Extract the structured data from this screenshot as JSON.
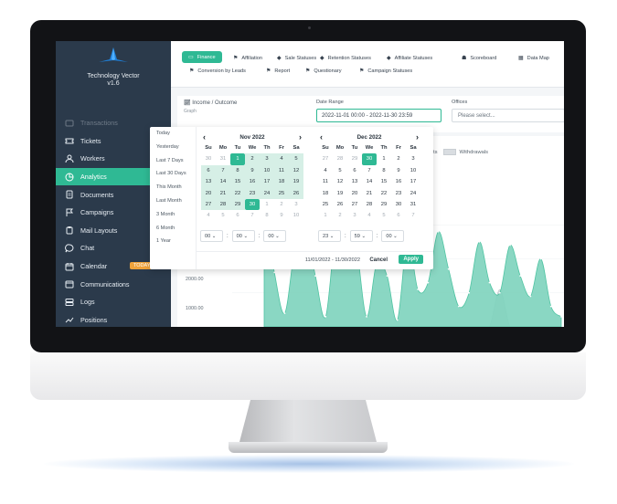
{
  "brand": {
    "name": "Technology Vector",
    "version": "v1.6"
  },
  "sidebar": {
    "items": [
      {
        "label": "Transactions",
        "icon": "transactions-icon",
        "state": "faded"
      },
      {
        "label": "Tickets",
        "icon": "ticket-icon"
      },
      {
        "label": "Workers",
        "icon": "user-icon"
      },
      {
        "label": "Analytics",
        "icon": "analytics-icon",
        "state": "active"
      },
      {
        "label": "Documents",
        "icon": "document-icon"
      },
      {
        "label": "Campaigns",
        "icon": "flag-icon"
      },
      {
        "label": "Mail Layouts",
        "icon": "clipboard-icon"
      },
      {
        "label": "Chat",
        "icon": "chat-icon"
      },
      {
        "label": "Calendar",
        "icon": "calendar-icon",
        "badge": "TODAY"
      },
      {
        "label": "Communications",
        "icon": "inbox-icon"
      },
      {
        "label": "Logs",
        "icon": "server-icon"
      },
      {
        "label": "Positions",
        "icon": "trend-icon"
      }
    ]
  },
  "tabs": [
    {
      "label": "Finance",
      "icon": "money-icon",
      "active": true
    },
    {
      "label": "Affiliation",
      "icon": "flag-icon"
    },
    {
      "label": "Sale Statuses",
      "icon": "tag-icon"
    },
    {
      "label": "Retention Statuses",
      "icon": "tag-icon"
    },
    {
      "label": "Affiliate Statuses",
      "icon": "tag-icon"
    },
    {
      "label": "Scoreboard",
      "icon": "users-icon"
    },
    {
      "label": "Data Map",
      "icon": "map-icon"
    },
    {
      "label": "Conversion by Leads",
      "icon": "flag-icon"
    },
    {
      "label": "Report",
      "icon": "flag-icon"
    },
    {
      "label": "Questionary",
      "icon": "flag-icon"
    },
    {
      "label": "Campaign Statuses",
      "icon": "flag-icon"
    }
  ],
  "filters": {
    "title": "Income / Outcome",
    "subtitle": "Graph",
    "date_range_label": "Date Range",
    "date_range_value": "2022-11-01 00:00 - 2022-11-30 23:59",
    "offices_label": "Offices",
    "offices_placeholder": "Please select..."
  },
  "picker": {
    "ranges": [
      "Today",
      "Yesterday",
      "Last 7 Days",
      "Last 30 Days",
      "This Month",
      "Last Month",
      "3 Month",
      "6 Month",
      "1 Year"
    ],
    "weekdays": [
      "Su",
      "Mo",
      "Tu",
      "We",
      "Th",
      "Fr",
      "Sa"
    ],
    "left": {
      "title": "Nov 2022",
      "days": [
        [
          "30",
          "off"
        ],
        [
          "31",
          "off"
        ],
        [
          "1",
          "sel"
        ],
        [
          "2",
          "inr"
        ],
        [
          "3",
          "inr"
        ],
        [
          "4",
          "inr"
        ],
        [
          "5",
          "inr"
        ],
        [
          "6",
          "inr"
        ],
        [
          "7",
          "inr"
        ],
        [
          "8",
          "inr"
        ],
        [
          "9",
          "inr"
        ],
        [
          "10",
          "inr"
        ],
        [
          "11",
          "inr"
        ],
        [
          "12",
          "inr"
        ],
        [
          "13",
          "inr"
        ],
        [
          "14",
          "inr"
        ],
        [
          "15",
          "inr"
        ],
        [
          "16",
          "inr"
        ],
        [
          "17",
          "inr"
        ],
        [
          "18",
          "inr"
        ],
        [
          "19",
          "inr"
        ],
        [
          "20",
          "inr"
        ],
        [
          "21",
          "inr"
        ],
        [
          "22",
          "inr"
        ],
        [
          "23",
          "inr"
        ],
        [
          "24",
          "inr"
        ],
        [
          "25",
          "inr"
        ],
        [
          "26",
          "inr"
        ],
        [
          "27",
          "inr"
        ],
        [
          "28",
          "inr"
        ],
        [
          "29",
          "inr"
        ],
        [
          "30",
          "sel"
        ],
        [
          "1",
          "off"
        ],
        [
          "2",
          "off"
        ],
        [
          "3",
          "off"
        ],
        [
          "4",
          "off"
        ],
        [
          "5",
          "off"
        ],
        [
          "6",
          "off"
        ],
        [
          "7",
          "off"
        ],
        [
          "8",
          "off"
        ],
        [
          "9",
          "off"
        ],
        [
          "10",
          "off"
        ]
      ],
      "time": [
        "00",
        "00",
        "00"
      ]
    },
    "right": {
      "title": "Dec 2022",
      "days": [
        [
          "27",
          "off"
        ],
        [
          "28",
          "off"
        ],
        [
          "29",
          "off"
        ],
        [
          "30",
          "sel"
        ],
        [
          "1",
          ""
        ],
        [
          "2",
          ""
        ],
        [
          "3",
          ""
        ],
        [
          "4",
          ""
        ],
        [
          "5",
          ""
        ],
        [
          "6",
          ""
        ],
        [
          "7",
          ""
        ],
        [
          "8",
          ""
        ],
        [
          "9",
          ""
        ],
        [
          "10",
          ""
        ],
        [
          "11",
          ""
        ],
        [
          "12",
          ""
        ],
        [
          "13",
          ""
        ],
        [
          "14",
          ""
        ],
        [
          "15",
          ""
        ],
        [
          "16",
          ""
        ],
        [
          "17",
          ""
        ],
        [
          "18",
          ""
        ],
        [
          "19",
          ""
        ],
        [
          "20",
          ""
        ],
        [
          "21",
          ""
        ],
        [
          "22",
          ""
        ],
        [
          "23",
          ""
        ],
        [
          "24",
          ""
        ],
        [
          "25",
          ""
        ],
        [
          "26",
          ""
        ],
        [
          "27",
          ""
        ],
        [
          "28",
          ""
        ],
        [
          "29",
          ""
        ],
        [
          "30",
          ""
        ],
        [
          "31",
          ""
        ],
        [
          "1",
          "off"
        ],
        [
          "2",
          "off"
        ],
        [
          "3",
          "off"
        ],
        [
          "4",
          "off"
        ],
        [
          "5",
          "off"
        ],
        [
          "6",
          "off"
        ],
        [
          "7",
          "off"
        ]
      ],
      "time": [
        "23",
        "59",
        "00"
      ]
    },
    "selected_text": "11/01/2022 - 11/30/2022",
    "cancel_label": "Cancel",
    "apply_label": "Apply"
  },
  "legend": {
    "partial_label": "ts",
    "withdrawals_label": "Withdrawals"
  },
  "colors": {
    "accent": "#2fb994",
    "sidebar": "#2b3a4b",
    "badge": "#f0a33b",
    "area_fill": "#7dd3bd",
    "withdrawals_fill": "#d9dde1"
  },
  "chart_data": {
    "type": "area",
    "yticks": [
      "2000.00",
      "1000.00"
    ],
    "series": [
      {
        "values": [
          3500,
          1600,
          400,
          2300,
          2950,
          1500,
          300,
          2900,
          3500,
          2400,
          300,
          1900,
          1500,
          200,
          2600,
          1100,
          1300,
          2800,
          1700,
          600,
          1000,
          2500,
          1300,
          1000,
          2400,
          1500,
          900,
          2000,
          600,
          300
        ]
      },
      {
        "values": [
          0,
          0,
          0,
          0,
          0,
          0,
          0,
          0,
          0,
          0,
          0,
          0,
          0,
          0,
          0,
          0,
          0,
          0,
          0,
          0,
          0,
          0,
          0,
          1100,
          0,
          0,
          0,
          0,
          0,
          0
        ]
      }
    ],
    "ylim": [
      0,
      4000
    ]
  }
}
